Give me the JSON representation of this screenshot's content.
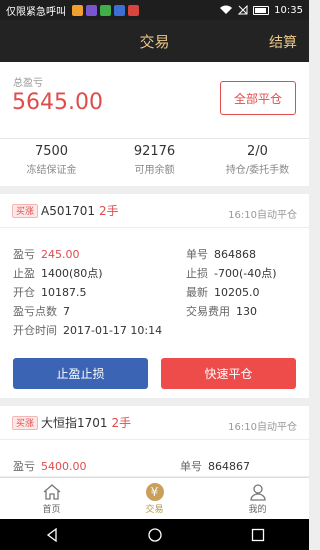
{
  "status_bar": {
    "carrier": "仅限紧急呼叫",
    "notification_icons": [
      {
        "name": "app-icon-1",
        "color": "#f0a030",
        "glyph": "▮"
      },
      {
        "name": "app-icon-2",
        "color": "#7a55d0",
        "glyph": "▮"
      },
      {
        "name": "app-icon-3",
        "color": "#3fae49",
        "glyph": "▮"
      },
      {
        "name": "app-icon-4",
        "color": "#3c6fd1",
        "glyph": "▮"
      },
      {
        "name": "app-icon-5",
        "color": "#d9453d",
        "glyph": "▮"
      }
    ],
    "time": "10:35"
  },
  "nav": {
    "title": "交易",
    "right_action": "结算"
  },
  "account": {
    "profit_label": "总盈亏",
    "profit_value": "5645.00",
    "close_all_button": "全部平仓",
    "stats": [
      {
        "value": "7500",
        "label": "冻结保证金"
      },
      {
        "value": "92176",
        "label": "可用余额"
      },
      {
        "value": "2/0",
        "label": "持仓/委托手数"
      }
    ]
  },
  "positions": [
    {
      "tag": "买涨",
      "code": "A501701",
      "lots": "2手",
      "auto_close": "16:10自动平仓",
      "left_fields": [
        {
          "label": "盈亏",
          "value": "245.00",
          "highlight": true
        },
        {
          "label": "止盈",
          "value": "1400(80点)"
        },
        {
          "label": "开仓",
          "value": "10187.5"
        },
        {
          "label": "盈亏点数",
          "value": "7"
        },
        {
          "label": "开仓时间",
          "value": "2017-01-17 10:14"
        }
      ],
      "right_fields": [
        {
          "label": "单号",
          "value": "864868"
        },
        {
          "label": "止损",
          "value": "-700(-40点)"
        },
        {
          "label": "最新",
          "value": "10205.0"
        },
        {
          "label": "交易费用",
          "value": "130"
        }
      ],
      "buttons": {
        "stop": "止盈止损",
        "quick_close": "快速平仓"
      }
    },
    {
      "tag": "买涨",
      "code": "大恒指1701",
      "lots": "2手",
      "auto_close": "16:10自动平仓",
      "left_fields": [
        {
          "label": "盈亏",
          "value": "5400.00",
          "highlight": true
        }
      ],
      "right_fields": [
        {
          "label": "单号",
          "value": "864867"
        }
      ]
    }
  ],
  "tabbar": {
    "items": [
      {
        "label": "首页",
        "icon": "home-icon"
      },
      {
        "label": "交易",
        "icon": "yuan-icon",
        "glyph": "¥"
      },
      {
        "label": "我的",
        "icon": "user-icon"
      }
    ]
  },
  "colors": {
    "accent_gold": "#e8c78a",
    "profit_red": "#e04c4c",
    "button_blue": "#3b64b4",
    "button_red": "#ee4b4b"
  }
}
